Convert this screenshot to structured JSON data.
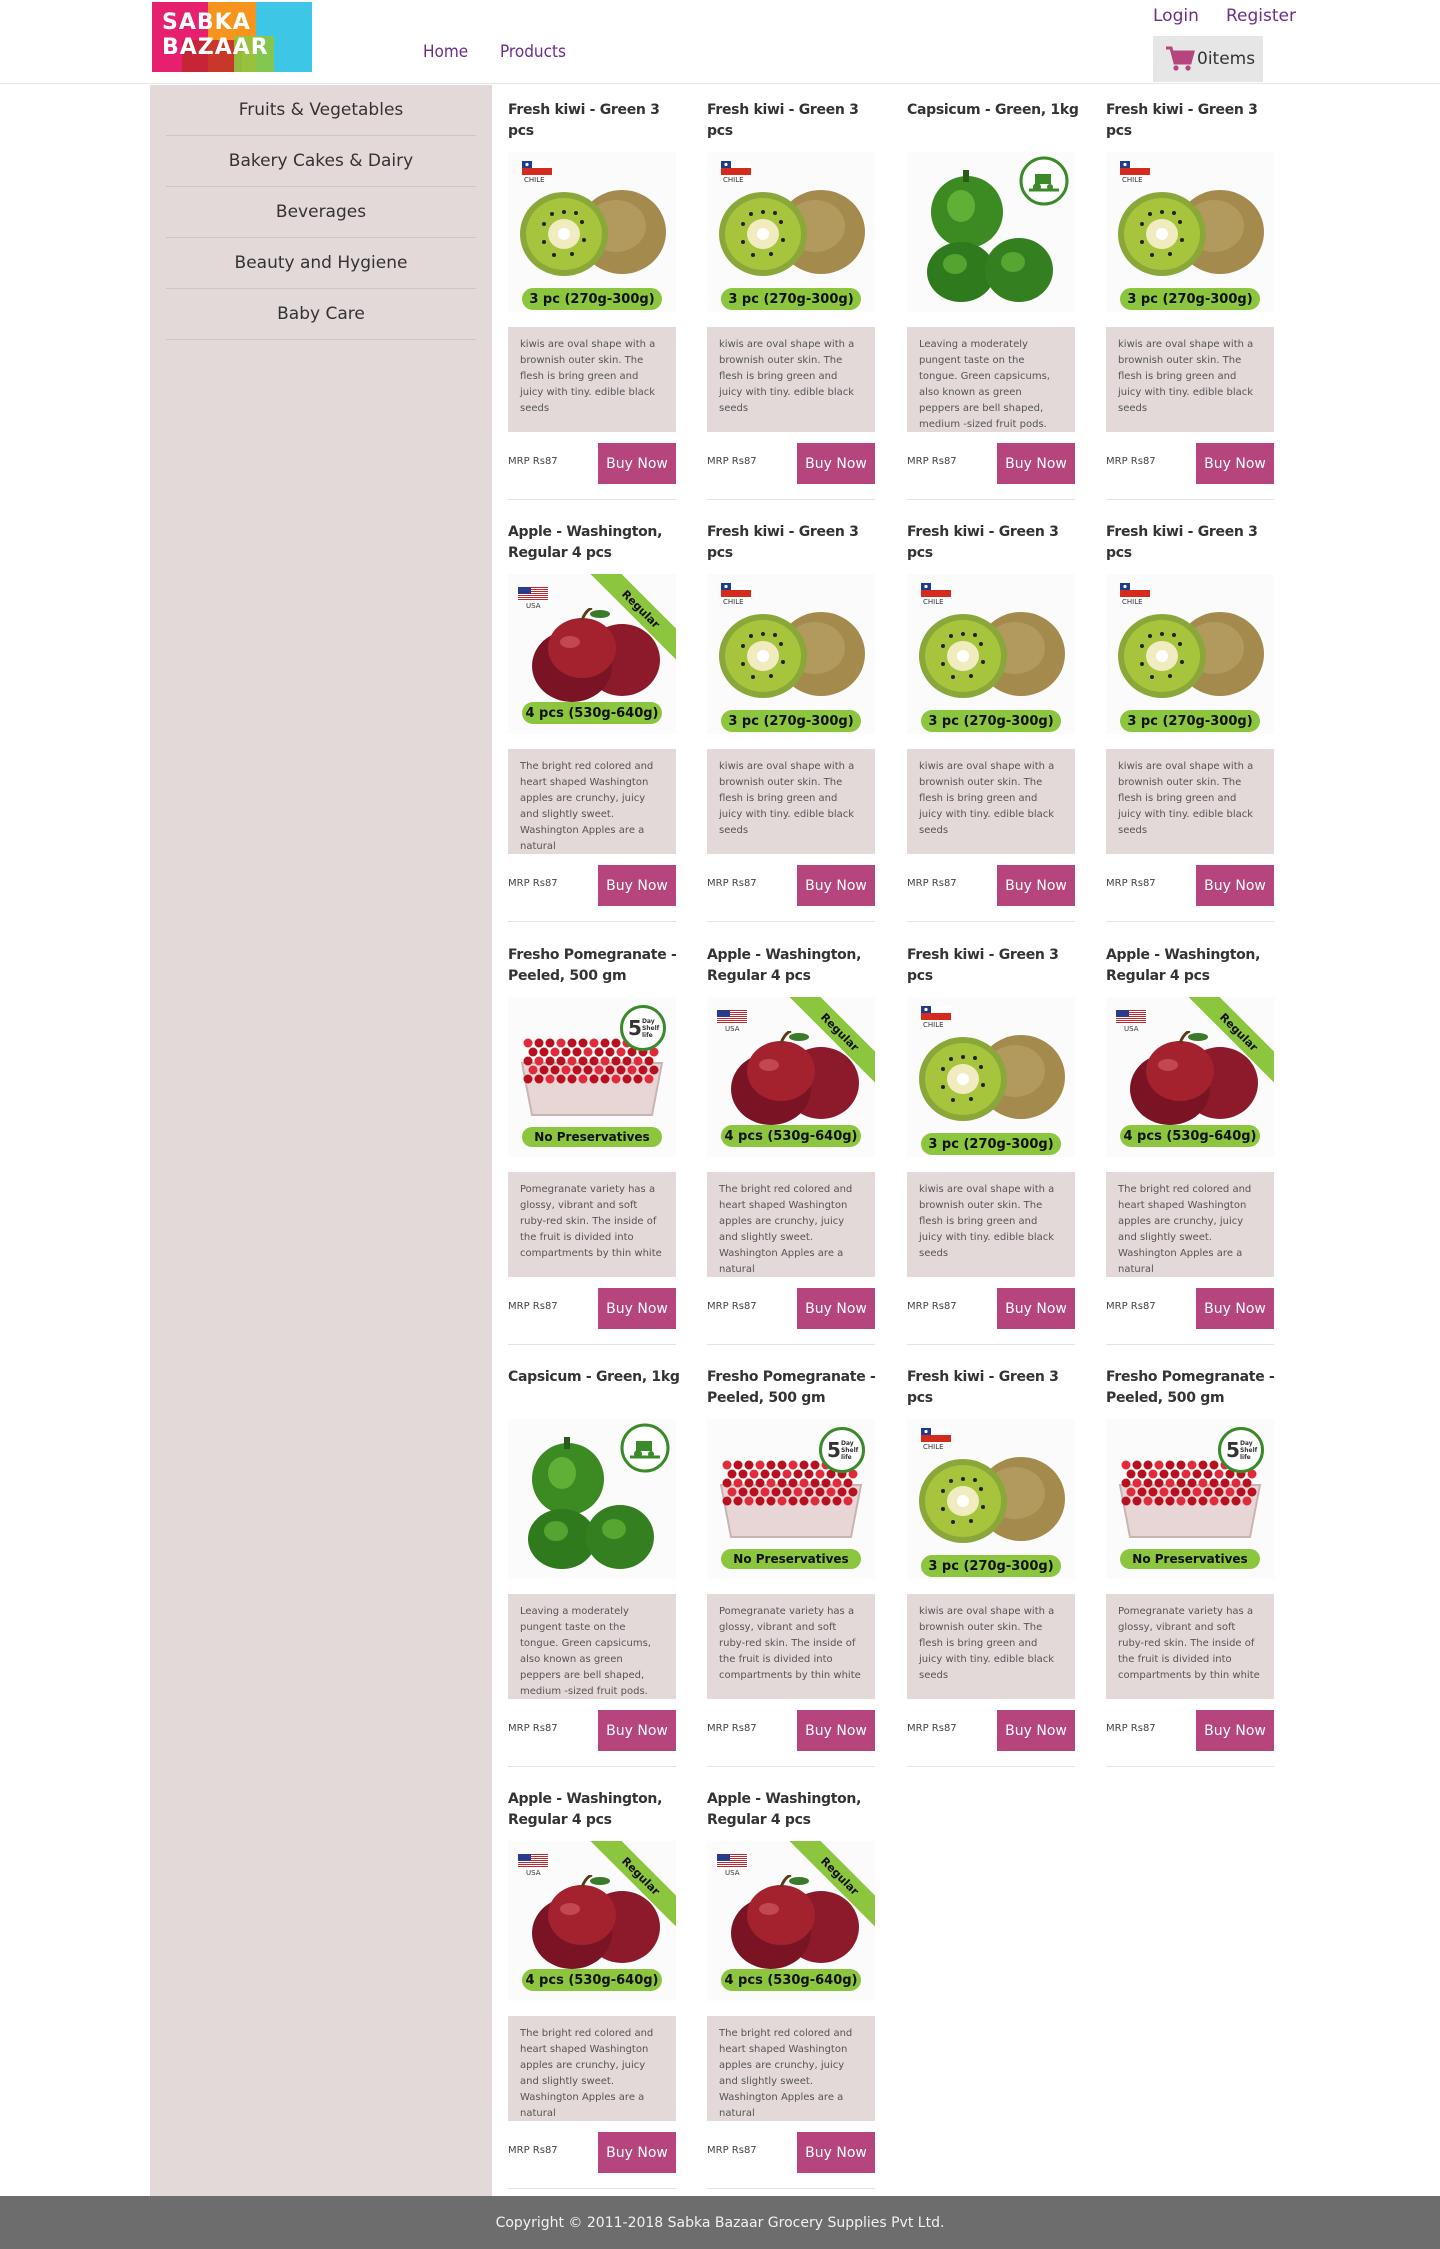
{
  "brand": {
    "logo_line1": "SABKA",
    "logo_line2": "BAZAAR"
  },
  "nav": {
    "home": "Home",
    "products": "Products"
  },
  "auth": {
    "login": "Login",
    "register": "Register"
  },
  "cart": {
    "label": "0items",
    "icon": "cart-icon"
  },
  "colors": {
    "accent": "#b5457c",
    "nav": "#6b2d8c",
    "sidebar_bg": "#e3d9d9",
    "footer_bg": "#6d6d6d"
  },
  "categories": [
    "Fruits & Vegetables",
    "Bakery Cakes & Dairy",
    "Beverages",
    "Beauty and Hygiene",
    "Baby Care"
  ],
  "product_types": {
    "kiwi": {
      "title": "Fresh kiwi - Green 3 pcs",
      "desc": "kiwis are oval shape with a brownish outer skin. The flesh is bring green and juicy with tiny. edible black seeds",
      "flag": "CHILE",
      "badge": "3 pc (270g-300g)"
    },
    "capsicum": {
      "title": "Capsicum - Green, 1kg",
      "desc": "Leaving a moderately pungent taste on the tongue. Green capsicums, also known as green peppers are bell shaped, medium -sized fruit pods."
    },
    "apple": {
      "title": "Apple - Washington, Regular 4 pcs",
      "desc": "The bright red colored and heart shaped Washington apples are crunchy, juicy and slightly sweet. Washington Apples are a natural",
      "flag": "USA",
      "badge": "4 pcs (530g-640g)",
      "ribbon": "Regular"
    },
    "pomegranate": {
      "title": "Fresho Pomegranate - Peeled, 500 gm",
      "desc": "Pomegranate variety has a glossy, vibrant and soft ruby-red skin. The inside of the fruit is divided into compartments by thin white",
      "badge": "No Preservatives",
      "seal_num": "5",
      "seal_text": "Day Shelf life"
    }
  },
  "products": [
    {
      "type": "kiwi",
      "price": "MRP Rs87",
      "buy": "Buy Now"
    },
    {
      "type": "kiwi",
      "price": "MRP Rs87",
      "buy": "Buy Now"
    },
    {
      "type": "capsicum",
      "price": "MRP Rs87",
      "buy": "Buy Now"
    },
    {
      "type": "kiwi",
      "price": "MRP Rs87",
      "buy": "Buy Now"
    },
    {
      "type": "apple",
      "price": "MRP Rs87",
      "buy": "Buy Now"
    },
    {
      "type": "kiwi",
      "price": "MRP Rs87",
      "buy": "Buy Now"
    },
    {
      "type": "kiwi",
      "price": "MRP Rs87",
      "buy": "Buy Now"
    },
    {
      "type": "kiwi",
      "price": "MRP Rs87",
      "buy": "Buy Now"
    },
    {
      "type": "pomegranate",
      "price": "MRP Rs87",
      "buy": "Buy Now"
    },
    {
      "type": "apple",
      "price": "MRP Rs87",
      "buy": "Buy Now"
    },
    {
      "type": "kiwi",
      "price": "MRP Rs87",
      "buy": "Buy Now"
    },
    {
      "type": "apple",
      "price": "MRP Rs87",
      "buy": "Buy Now"
    },
    {
      "type": "capsicum",
      "price": "MRP Rs87",
      "buy": "Buy Now"
    },
    {
      "type": "pomegranate",
      "price": "MRP Rs87",
      "buy": "Buy Now"
    },
    {
      "type": "kiwi",
      "price": "MRP Rs87",
      "buy": "Buy Now"
    },
    {
      "type": "pomegranate",
      "price": "MRP Rs87",
      "buy": "Buy Now"
    },
    {
      "type": "apple",
      "price": "MRP Rs87",
      "buy": "Buy Now"
    },
    {
      "type": "apple",
      "price": "MRP Rs87",
      "buy": "Buy Now"
    }
  ],
  "footer": {
    "copyright": "Copyright © 2011-2018 Sabka Bazaar Grocery Supplies Pvt Ltd."
  }
}
